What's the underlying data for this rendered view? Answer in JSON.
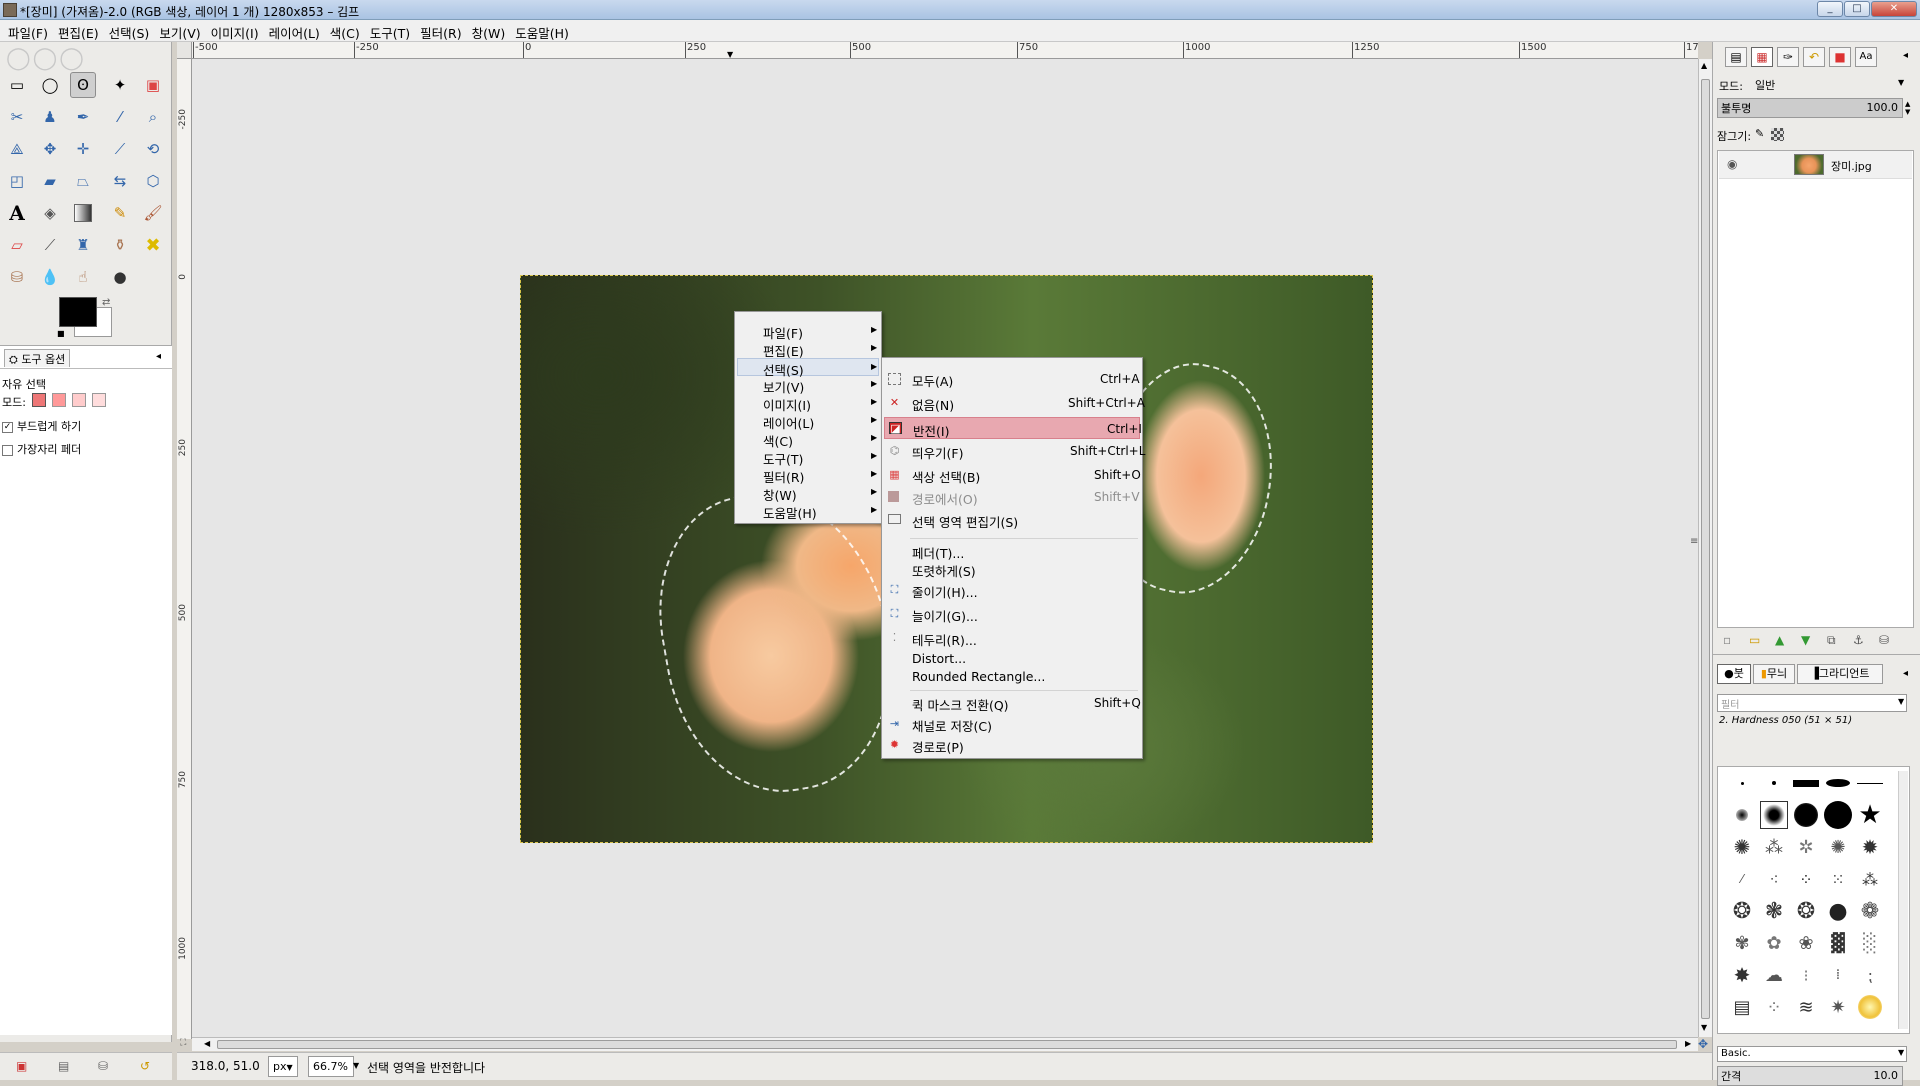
{
  "window": {
    "title": "*[장미] (가져옴)-2.0 (RGB 색상, 레이어 1 개) 1280x853 – 김프",
    "minimize": "_",
    "maximize": "□",
    "close": "✕"
  },
  "menubar": [
    "파일(F)",
    "편집(E)",
    "선택(S)",
    "보기(V)",
    "이미지(I)",
    "레이어(L)",
    "색(C)",
    "도구(T)",
    "필터(R)",
    "창(W)",
    "도움말(H)"
  ],
  "ruler": {
    "h_ticks": [
      "-500",
      "-250",
      "0",
      "250",
      "500",
      "750",
      "1000",
      "1250",
      "1500",
      "17"
    ],
    "v_ticks": [
      "-250",
      "0",
      "250",
      "500",
      "750",
      "1000"
    ]
  },
  "tool_options": {
    "tab_label": "도구 옵션",
    "tool_name": "자유 선택",
    "mode_label": "모드:",
    "antialias_label": "부드럽게 하기",
    "antialias_checked": true,
    "feather_label": "가장자리 페더",
    "feather_checked": false
  },
  "status": {
    "coords": "318.0, 51.0",
    "unit": "px",
    "zoom": "66.7%",
    "message": "선택 영역을 반전합니다"
  },
  "dock": {
    "mode_label": "모드:",
    "mode_value": "일반",
    "opacity_label": "불투명",
    "opacity_value": "100.0",
    "lock_label": "잠그기:",
    "layer_name": "장미.jpg",
    "brush_tabs": [
      "붓",
      "무늬",
      "그라디언트"
    ],
    "brush_filter_placeholder": "필터",
    "brush_name": "2. Hardness 050 (51 × 51)",
    "preset_value": "Basic.",
    "spacing_label": "간격",
    "spacing_value": "10.0"
  },
  "context_menu": {
    "items": [
      "파일(F)",
      "편집(E)",
      "선택(S)",
      "보기(V)",
      "이미지(I)",
      "레이어(L)",
      "색(C)",
      "도구(T)",
      "필터(R)",
      "창(W)",
      "도움말(H)"
    ],
    "active_index": 2
  },
  "select_submenu": {
    "items": [
      {
        "label": "모두(A)",
        "shortcut": "Ctrl+A",
        "icon": "select-all-icon",
        "disabled": false
      },
      {
        "label": "없음(N)",
        "shortcut": "Shift+Ctrl+A",
        "icon": "select-none-icon",
        "disabled": false
      },
      {
        "label": "반전(I)",
        "shortcut": "Ctrl+I",
        "icon": "invert-selection-icon",
        "disabled": false
      },
      {
        "label": "띄우기(F)",
        "shortcut": "Shift+Ctrl+L",
        "icon": "float-icon",
        "disabled": false
      },
      {
        "label": "색상 선택(B)",
        "shortcut": "Shift+O",
        "icon": "by-color-icon",
        "disabled": false
      },
      {
        "label": "경로에서(O)",
        "shortcut": "Shift+V",
        "icon": "from-path-icon",
        "disabled": true
      },
      {
        "label": "선택 영역 편집기(S)",
        "shortcut": "",
        "icon": "selection-editor-icon",
        "disabled": false
      },
      {
        "label": "페더(T)...",
        "shortcut": "",
        "icon": "",
        "disabled": false
      },
      {
        "label": "또렷하게(S)",
        "shortcut": "",
        "icon": "",
        "disabled": false
      },
      {
        "label": "줄이기(H)...",
        "shortcut": "",
        "icon": "shrink-icon",
        "disabled": false
      },
      {
        "label": "늘이기(G)...",
        "shortcut": "",
        "icon": "grow-icon",
        "disabled": false
      },
      {
        "label": "테두리(R)...",
        "shortcut": "",
        "icon": "border-icon",
        "disabled": false
      },
      {
        "label": "Distort...",
        "shortcut": "",
        "icon": "",
        "disabled": false
      },
      {
        "label": "Rounded Rectangle...",
        "shortcut": "",
        "icon": "",
        "disabled": false
      },
      {
        "label": "퀵 마스크 전환(Q)",
        "shortcut": "Shift+Q",
        "icon": "",
        "disabled": false
      },
      {
        "label": "채널로 저장(C)",
        "shortcut": "",
        "icon": "save-channel-icon",
        "disabled": false
      },
      {
        "label": "경로로(P)",
        "shortcut": "",
        "icon": "to-path-icon",
        "disabled": false
      }
    ],
    "highlighted_index": 2
  }
}
